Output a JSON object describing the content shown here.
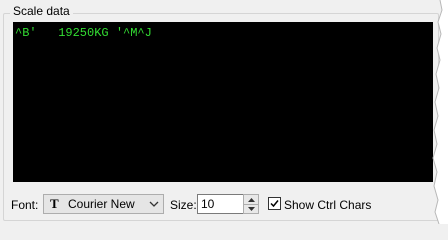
{
  "group": {
    "title": "Scale data"
  },
  "terminal": {
    "text": "^B'   19250KG '^M^J"
  },
  "font": {
    "label": "Font:",
    "selected": "Courier New",
    "icon": "truetype-font-icon"
  },
  "size": {
    "label": "Size:",
    "value": "10"
  },
  "ctrl_chars": {
    "label": "Show Ctrl Chars",
    "checked": true
  },
  "colors": {
    "terminal_bg": "#000000",
    "terminal_fg": "#33dd33"
  }
}
